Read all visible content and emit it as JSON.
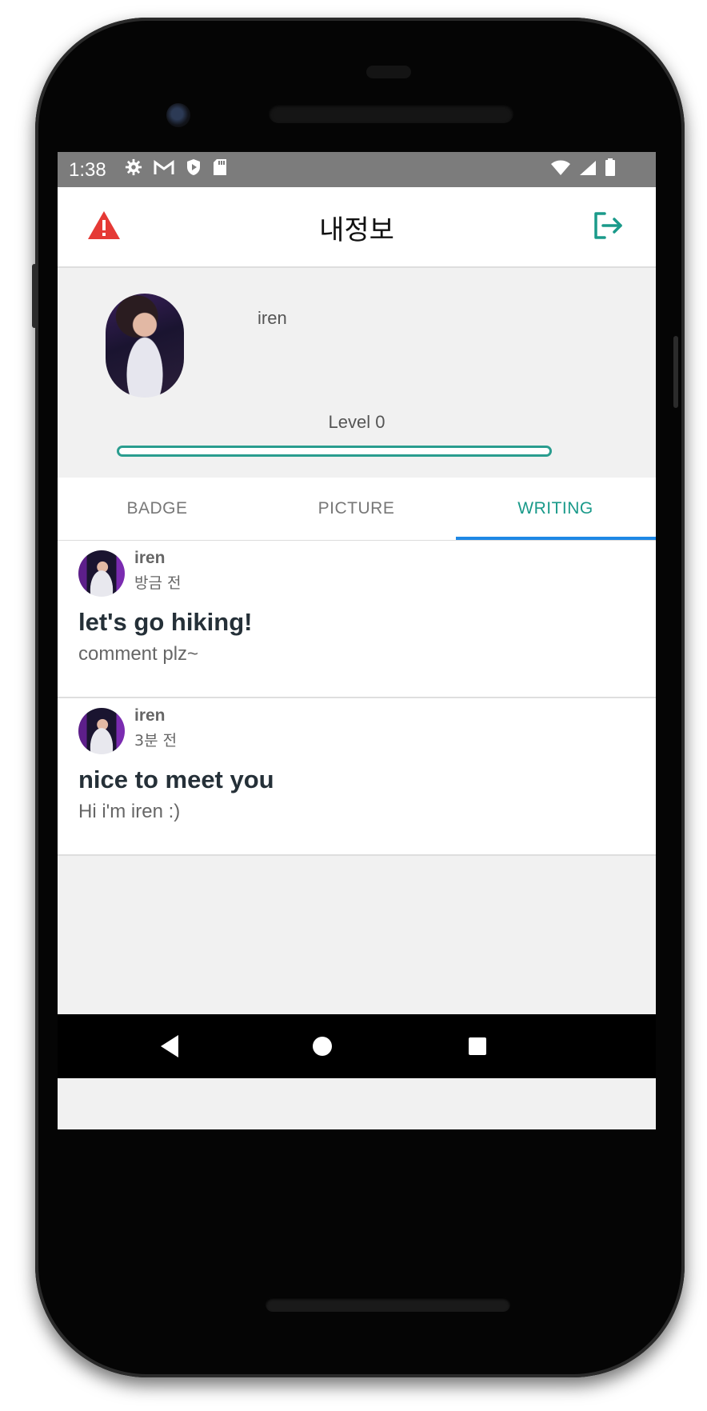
{
  "status_bar": {
    "time": "1:38",
    "left_icons": [
      "settings-icon",
      "gmail-icon",
      "shield-play-icon",
      "sd-card-icon"
    ],
    "right_icons": [
      "wifi-icon",
      "signal-icon",
      "battery-icon"
    ]
  },
  "app_bar": {
    "title": "내정보",
    "left_icon": "warning-icon",
    "right_icon": "logout-icon",
    "warning_color": "#e53935",
    "accent_color": "#1a9a8a"
  },
  "profile": {
    "name": "iren",
    "level_label": "Level 0",
    "level_progress": 0
  },
  "tabs": [
    {
      "label": "BADGE",
      "active": false
    },
    {
      "label": "PICTURE",
      "active": false
    },
    {
      "label": "WRITING",
      "active": true
    }
  ],
  "posts": [
    {
      "author": "iren",
      "time": "방금 전",
      "title": "let's go hiking!",
      "body": "comment plz~"
    },
    {
      "author": "iren",
      "time": "3분 전",
      "title": "nice to meet you",
      "body": "Hi i'm iren :)"
    }
  ],
  "nav_bar": {
    "buttons": [
      "back-icon",
      "home-icon",
      "recents-icon"
    ]
  }
}
